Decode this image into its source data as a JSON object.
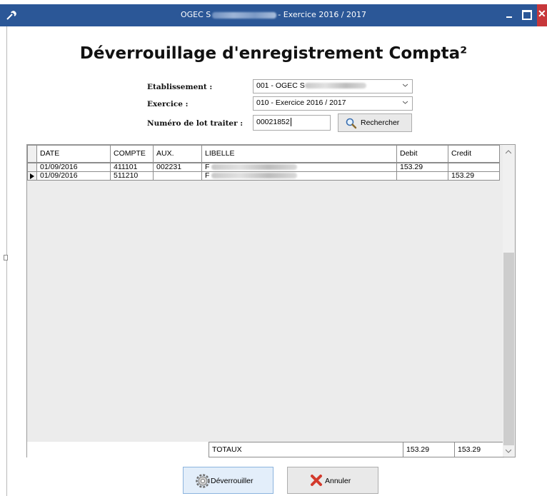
{
  "window": {
    "title_prefix": "OGEC S",
    "title_suffix": "- Exercice 2016 / 2017"
  },
  "page": {
    "title": "Déverrouillage d'enregistrement Compta²"
  },
  "form": {
    "etablissement_label": "Etablissement :",
    "etablissement_value": "001 - OGEC S",
    "exercice_label": "Exercice :",
    "exercice_value": "010 - Exercice 2016 / 2017",
    "lot_label": "Numéro de lot traiter :",
    "lot_value": "00021852",
    "search_label": "Rechercher"
  },
  "grid": {
    "columns": [
      "DATE",
      "COMPTE",
      "AUX.",
      "LIBELLE",
      "Debit",
      "Credit"
    ],
    "rows": [
      {
        "date": "01/09/2016",
        "compte": "411101",
        "aux": "002231",
        "libelle": "F",
        "debit": "153.29",
        "credit": "",
        "current": false
      },
      {
        "date": "01/09/2016",
        "compte": "511210",
        "aux": "",
        "libelle": "F",
        "debit": "",
        "credit": "153.29",
        "current": true
      }
    ],
    "totals_label": "TOTAUX",
    "total_debit": "153.29",
    "total_credit": "153.29"
  },
  "buttons": {
    "unlock_label": "Déverrouiller",
    "cancel_label": "Annuler"
  },
  "icons": {
    "app": "wrench-icon",
    "search": "magnifier-icon",
    "unlock": "gear-icon",
    "cancel": "red-x-icon"
  }
}
